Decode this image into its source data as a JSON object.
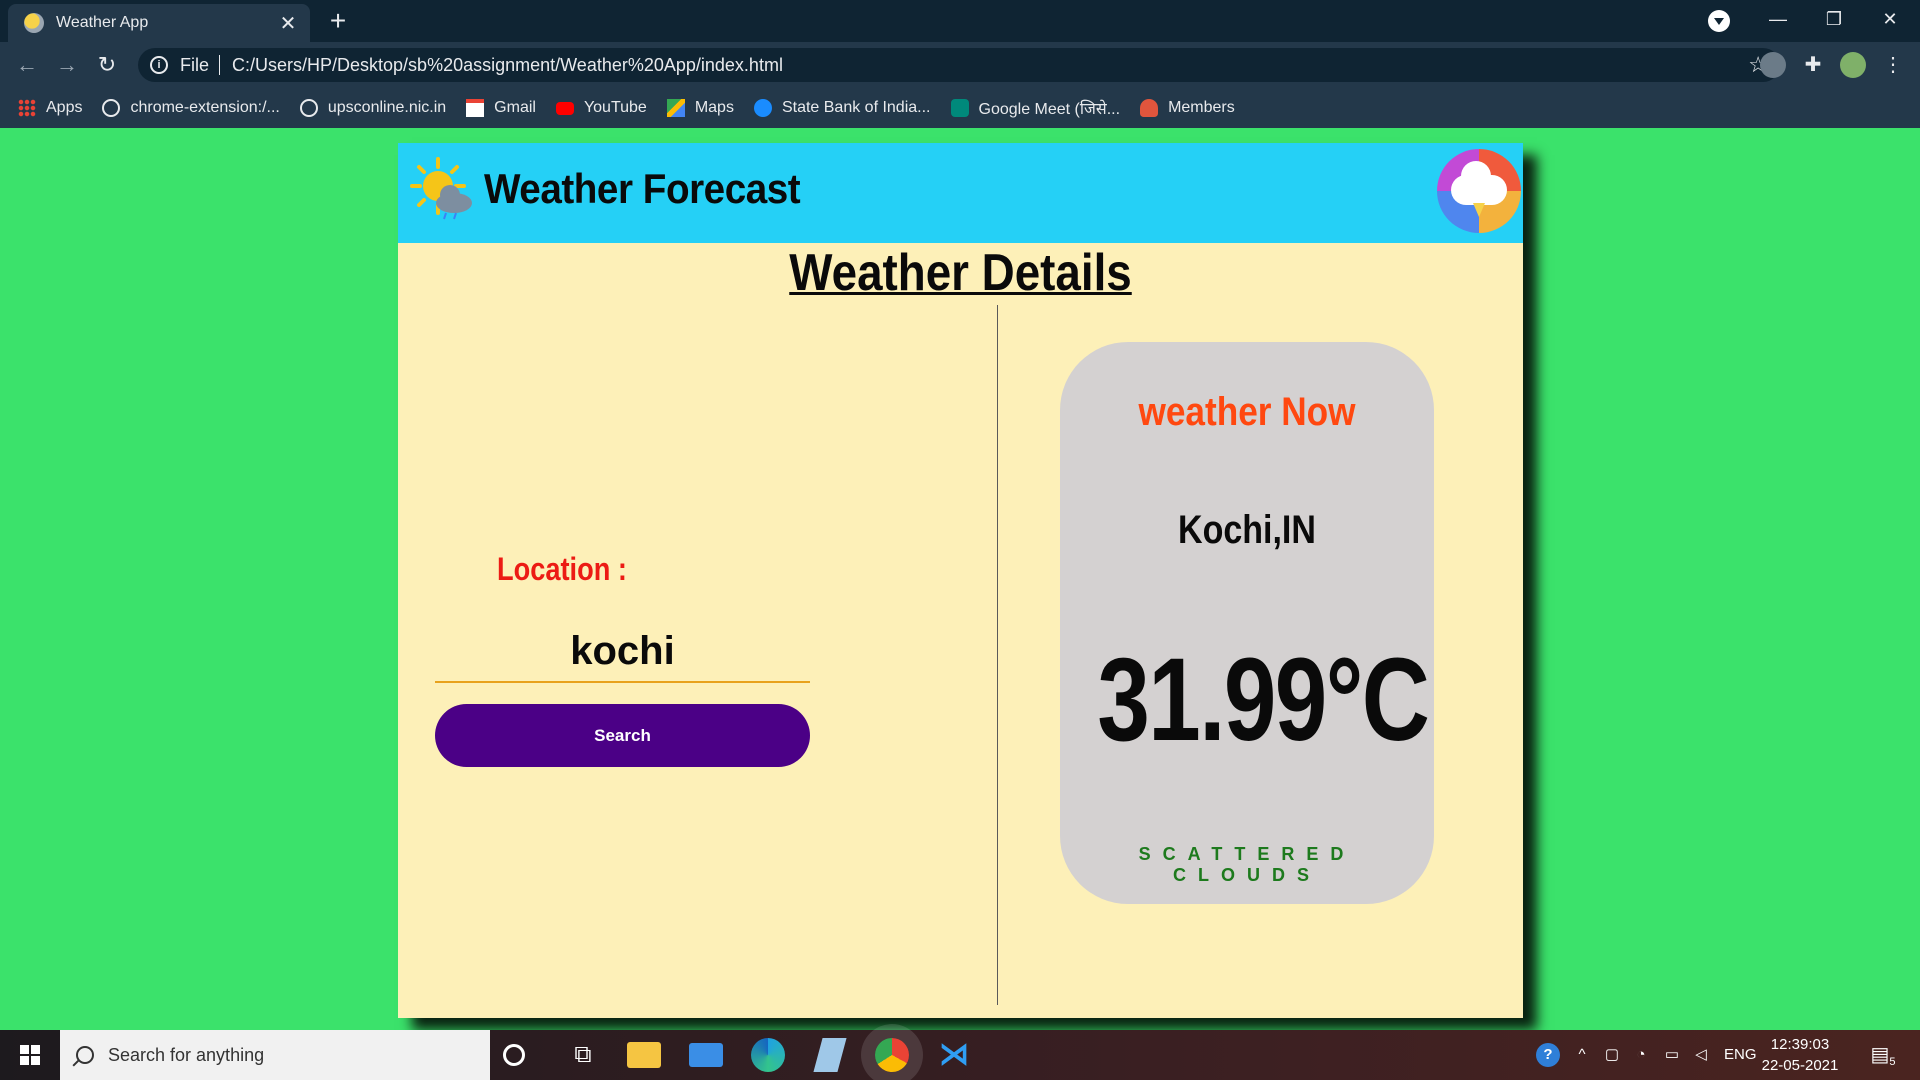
{
  "browser": {
    "tab_title": "Weather App",
    "url_scheme": "File",
    "url": "C:/Users/HP/Desktop/sb%20assignment/Weather%20App/index.html",
    "bookmarks": [
      {
        "label": "Apps"
      },
      {
        "label": "chrome-extension:/..."
      },
      {
        "label": "upsconline.nic.in"
      },
      {
        "label": "Gmail"
      },
      {
        "label": "YouTube"
      },
      {
        "label": "Maps"
      },
      {
        "label": "State Bank of India..."
      },
      {
        "label": "Google Meet (जिसे..."
      },
      {
        "label": "Members"
      }
    ]
  },
  "app": {
    "title": "Weather Forecast",
    "section_title": "Weather Details",
    "location_label": "Location  :",
    "location_value": "kochi",
    "search_label": "Search"
  },
  "weather_now": {
    "title": "weather Now",
    "city": "Kochi,IN",
    "temperature": "31.99°C",
    "description": "SCATTERED CLOUDS"
  },
  "taskbar": {
    "search_placeholder": "Search for anything",
    "language": "ENG",
    "time": "12:39:03",
    "date": "22-05-2021",
    "notification_count": "5"
  },
  "colors": {
    "page_background": "#3be26b",
    "header_background": "#25d0f6",
    "card_background": "#fdf0b8",
    "search_button": "#4b0086",
    "location_label": "#ec1b14",
    "now_title": "#ff4810",
    "description": "#1d7a1d"
  }
}
